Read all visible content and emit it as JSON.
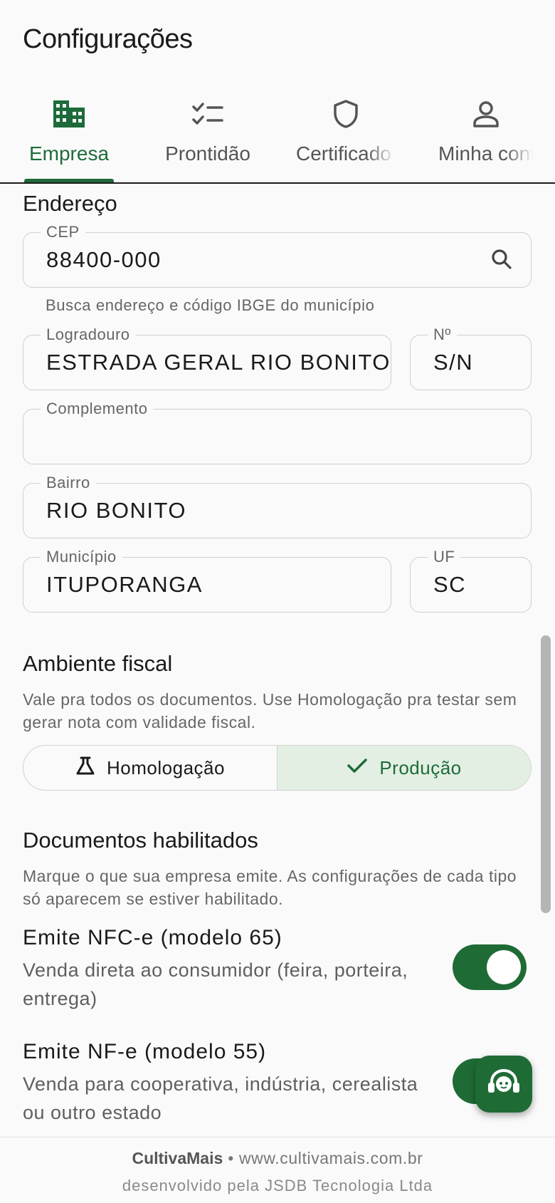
{
  "header": {
    "title": "Configurações"
  },
  "tabs": [
    {
      "label": "Empresa",
      "icon": "building-icon",
      "active": true
    },
    {
      "label": "Prontidão",
      "icon": "checklist-icon",
      "active": false
    },
    {
      "label": "Certificado",
      "icon": "shield-icon",
      "active": false
    },
    {
      "label": "Minha conta",
      "icon": "person-icon",
      "active": false
    }
  ],
  "endereco": {
    "title": "Endereço",
    "cep": {
      "label": "CEP",
      "value": "88400-000",
      "helper": "Busca endereço e código IBGE do município"
    },
    "logradouro": {
      "label": "Logradouro",
      "value": "ESTRADA GERAL RIO BONITO"
    },
    "numero": {
      "label": "Nº",
      "value": "S/N"
    },
    "complemento": {
      "label": "Complemento",
      "value": ""
    },
    "bairro": {
      "label": "Bairro",
      "value": "RIO BONITO"
    },
    "municipio": {
      "label": "Município",
      "value": "ITUPORANGA"
    },
    "uf": {
      "label": "UF",
      "value": "SC"
    }
  },
  "ambiente": {
    "title": "Ambiente fiscal",
    "description": "Vale pra todos os documentos. Use Homologação pra testar sem gerar nota com validade fiscal.",
    "options": [
      "Homologação",
      "Produção"
    ],
    "selected": "Produção"
  },
  "documentos": {
    "title": "Documentos habilitados",
    "description": "Marque o que sua empresa emite. As configurações de cada tipo só aparecem se estiver habilitado.",
    "items": [
      {
        "title": "Emite NFC-e (modelo 65)",
        "description": "Venda direta ao consumidor (feira, porteira, entrega)",
        "enabled": true
      },
      {
        "title": "Emite NF-e (modelo 55)",
        "description": "Venda para cooperativa, indústria, cerealista ou outro estado",
        "enabled": true
      }
    ]
  },
  "footer": {
    "brand": "CultivaMais",
    "separator": "•",
    "url": "www.cultivamais.com.br",
    "credit": "desenvolvido pela JSDB Tecnologia Ltda"
  },
  "colors": {
    "accent": "#1e6b3a",
    "switch_on": "#1f6b35",
    "selected_bg": "#e3efe3"
  }
}
